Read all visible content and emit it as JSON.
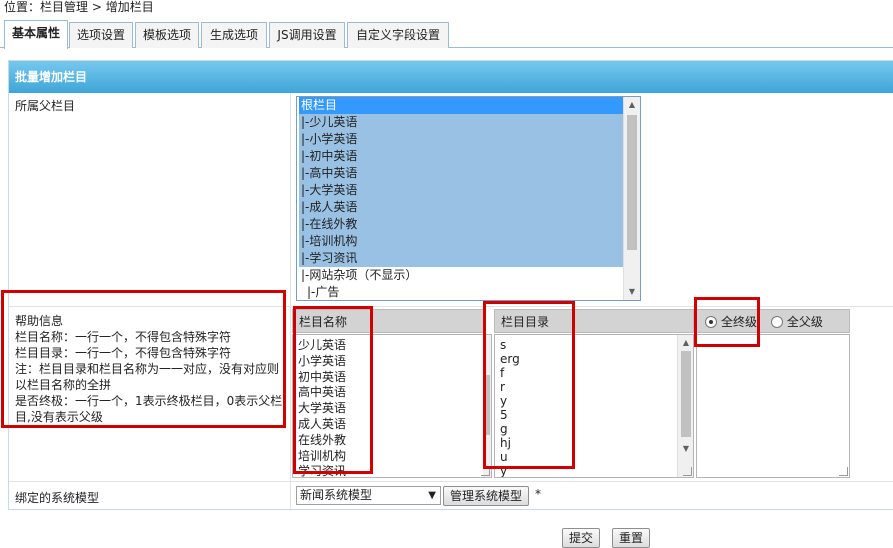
{
  "breadcrumb": {
    "prefix": "位置：",
    "item1": "栏目管理",
    "sep": " > ",
    "item2": "增加栏目"
  },
  "tabs": [
    "基本属性",
    "选项设置",
    "模板选项",
    "生成选项",
    "JS调用设置",
    "自定义字段设置"
  ],
  "panel": {
    "title": "批量增加栏目"
  },
  "parent": {
    "label": "所属父栏目",
    "options": [
      "根栏目",
      "|-少儿英语",
      "|-小学英语",
      "|-初中英语",
      "|-高中英语",
      "|-大学英语",
      "|-成人英语",
      "|-在线外教",
      "|-培训机构",
      "|-学习资讯",
      "|-网站杂项（不显示）",
      " |-广告"
    ]
  },
  "help": {
    "title": "帮助信息",
    "line1": "栏目名称：一行一个，不得包含特殊字符",
    "line2": "栏目目录：一行一个，不得包含特殊字符",
    "line3": "注：栏目目录和栏目名称为一一对应，没有对应则以栏目名称的全拼",
    "line4": "是否终极：一行一个，1表示终极栏目，0表示父栏目,没有表示父级"
  },
  "columns": {
    "name_header": "栏目名称",
    "dir_header": "栏目目录",
    "names": [
      "少儿英语",
      "小学英语",
      "初中英语",
      "高中英语",
      "大学英语",
      "成人英语",
      "在线外教",
      "培训机构",
      "学习资讯"
    ],
    "dirs": [
      "s",
      "erg",
      "f",
      "r",
      "y",
      "5",
      "g",
      "hj",
      "u",
      "y"
    ],
    "radio_all_final": "全终级",
    "radio_all_parent": "全父级",
    "selected_radio": "全终级"
  },
  "model": {
    "label": "绑定的系统模型",
    "selected": "新闻系统模型",
    "manage_button": "管理系统模型",
    "required_mark": "*"
  },
  "footer": {
    "submit": "提交",
    "reset": "重置"
  }
}
